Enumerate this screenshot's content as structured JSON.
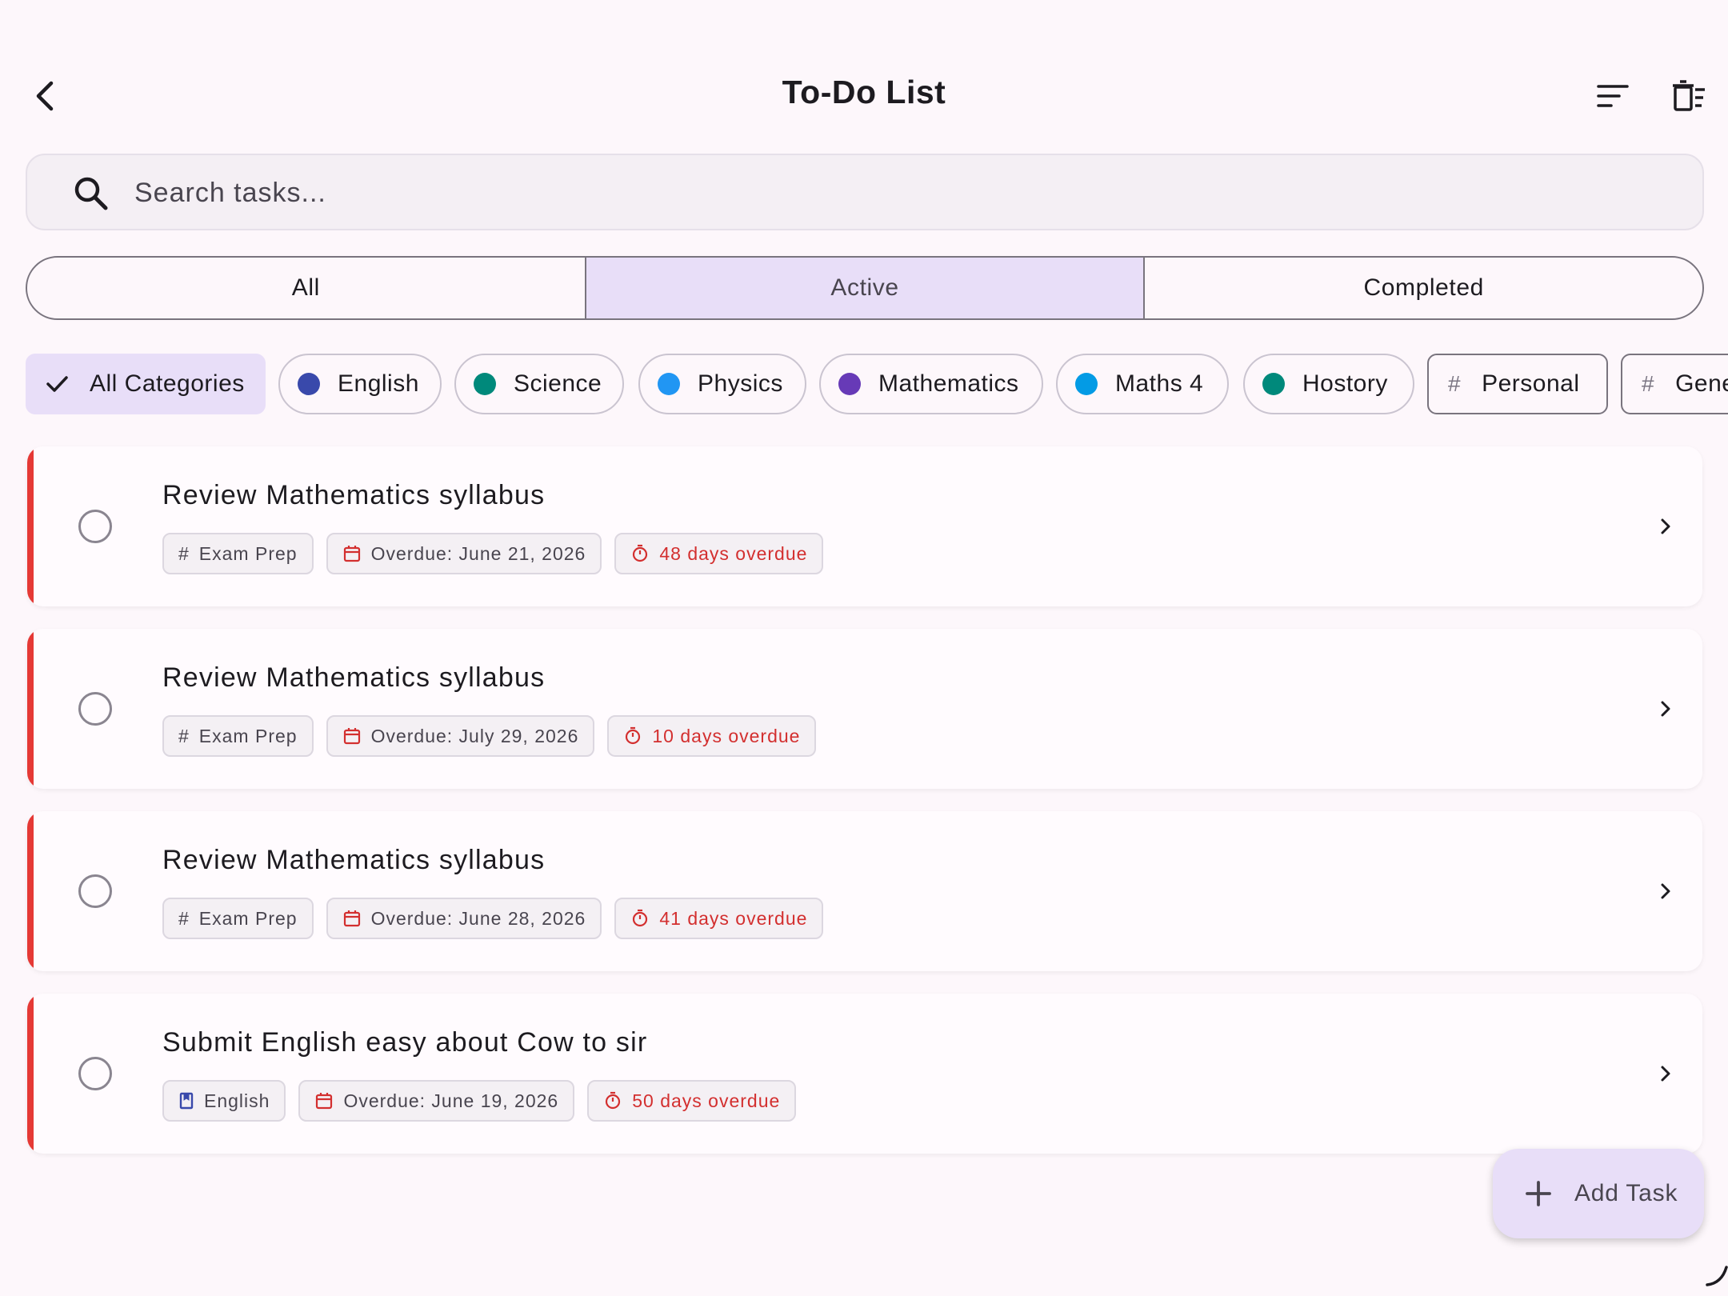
{
  "app_bar": {
    "title": "To-Do List",
    "back_icon": "arrow-back-icon",
    "sort_icon": "sort-icon",
    "clear_icon": "delete-sweep-icon"
  },
  "search": {
    "placeholder": "Search tasks...",
    "value": ""
  },
  "filter_tabs": [
    {
      "label": "All",
      "selected": false
    },
    {
      "label": "Active",
      "selected": true
    },
    {
      "label": "Completed",
      "selected": false
    }
  ],
  "categories": [
    {
      "label": "All Categories",
      "selected": true,
      "icon": "check-icon"
    },
    {
      "label": "English",
      "color": "#3949ab"
    },
    {
      "label": "Science",
      "color": "#00897b"
    },
    {
      "label": "Physics",
      "color": "#2196f3"
    },
    {
      "label": "Mathematics",
      "color": "#673ab7"
    },
    {
      "label": "Maths 4",
      "color": "#039be5"
    },
    {
      "label": "Hostory",
      "color": "#00897b"
    },
    {
      "label": "Personal",
      "icon": "hash-icon"
    },
    {
      "label": "Gene",
      "icon": "hash-icon"
    }
  ],
  "tasks": [
    {
      "title": "Review Mathematics syllabus",
      "category": "Exam Prep",
      "category_icon": "hash-icon",
      "due": "Overdue: June 21, 2026",
      "overdue": "48 days overdue"
    },
    {
      "title": "Review Mathematics syllabus",
      "category": "Exam Prep",
      "category_icon": "hash-icon",
      "due": "Overdue: July 29, 2026",
      "overdue": "10 days overdue"
    },
    {
      "title": "Review Mathematics syllabus",
      "category": "Exam Prep",
      "category_icon": "hash-icon",
      "due": "Overdue: June 28, 2026",
      "overdue": "41 days overdue"
    },
    {
      "title": "Submit English easy about Cow to sir",
      "category": "English",
      "category_icon": "book-icon",
      "due": "Overdue: June 19, 2026",
      "overdue": "50 days overdue"
    }
  ],
  "fab": {
    "label": "Add Task",
    "icon": "plus-icon"
  },
  "colors": {
    "background": "#fdf7fb",
    "accent": "#e8def8",
    "overdue_red": "#d32f2f",
    "card_stripe": "#e53935"
  }
}
